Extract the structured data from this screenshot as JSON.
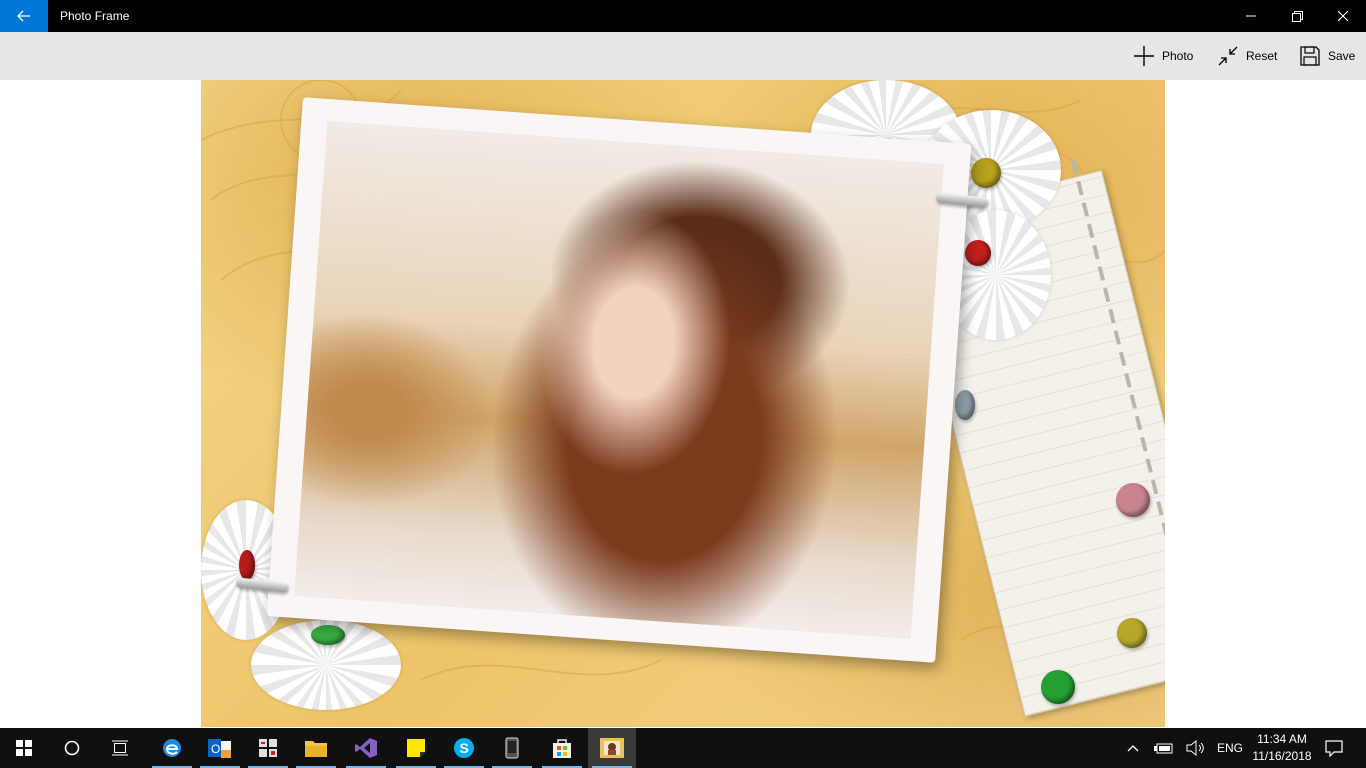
{
  "window": {
    "title": "Photo Frame",
    "back_icon": "back-arrow-icon",
    "accent": "#0078d7"
  },
  "commands": {
    "photo_label": "Photo",
    "reset_label": "Reset",
    "save_label": "Save"
  },
  "canvas": {
    "background_color": "#f1d183",
    "frame_color": "#faf6f5"
  },
  "taskbar": {
    "apps": [
      "start-icon",
      "cortana-icon",
      "task-view-icon",
      "edge-icon",
      "outlook-icon",
      "calculator-icon",
      "file-explorer-icon",
      "visual-studio-icon",
      "sticky-notes-icon",
      "skype-icon",
      "phone-icon",
      "store-icon",
      "photo-frame-icon"
    ],
    "language": "ENG",
    "time": "11:34 AM",
    "date": "11/16/2018"
  }
}
